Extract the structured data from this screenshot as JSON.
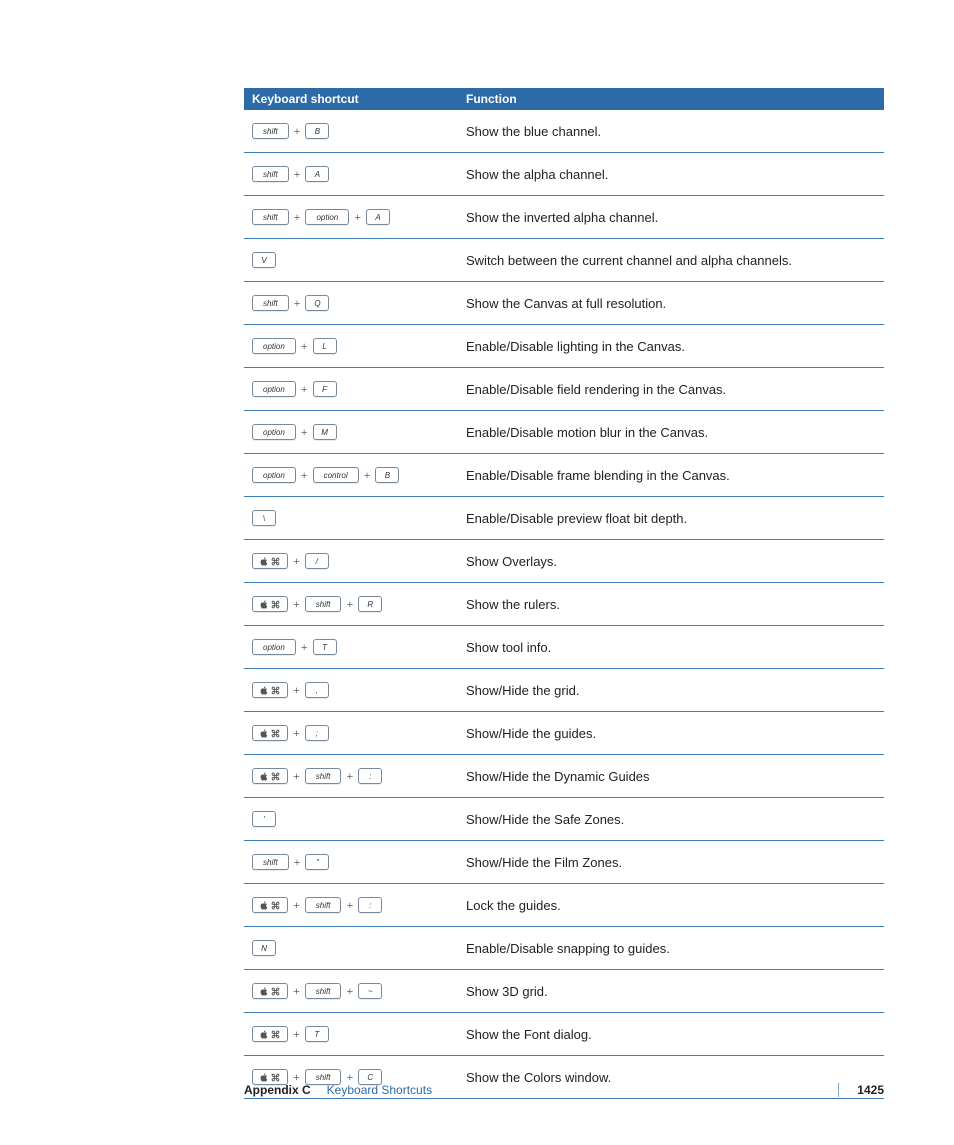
{
  "table": {
    "columns": [
      "Keyboard shortcut",
      "Function"
    ],
    "rows": [
      {
        "keys": [
          [
            "shift",
            "wide"
          ],
          [
            "B",
            "key"
          ]
        ],
        "func": "Show the blue channel."
      },
      {
        "keys": [
          [
            "shift",
            "wide"
          ],
          [
            "A",
            "key"
          ]
        ],
        "func": "Show the alpha channel."
      },
      {
        "keys": [
          [
            "shift",
            "wide"
          ],
          [
            "option",
            "wide"
          ],
          [
            "A",
            "key"
          ]
        ],
        "func": "Show the inverted alpha channel."
      },
      {
        "keys": [
          [
            "V",
            "key"
          ]
        ],
        "func": "Switch between the current channel and alpha channels."
      },
      {
        "keys": [
          [
            "shift",
            "wide"
          ],
          [
            "Q",
            "key"
          ]
        ],
        "func": "Show the Canvas at full resolution."
      },
      {
        "keys": [
          [
            "option",
            "wide"
          ],
          [
            "L",
            "key"
          ]
        ],
        "func": "Enable/Disable lighting in the Canvas."
      },
      {
        "keys": [
          [
            "option",
            "wide"
          ],
          [
            "F",
            "key"
          ]
        ],
        "func": "Enable/Disable field rendering in the Canvas."
      },
      {
        "keys": [
          [
            "option",
            "wide"
          ],
          [
            "M",
            "key"
          ]
        ],
        "func": "Enable/Disable motion blur in the Canvas."
      },
      {
        "keys": [
          [
            "option",
            "wide"
          ],
          [
            "control",
            "wide"
          ],
          [
            "B",
            "key"
          ]
        ],
        "func": "Enable/Disable frame blending in the Canvas."
      },
      {
        "keys": [
          [
            "\\",
            "key"
          ]
        ],
        "func": "Enable/Disable preview float bit depth."
      },
      {
        "keys": [
          [
            "cmd",
            "cmd"
          ],
          [
            "/",
            "key"
          ]
        ],
        "func": "Show Overlays."
      },
      {
        "keys": [
          [
            "cmd",
            "cmd"
          ],
          [
            "shift",
            "wide"
          ],
          [
            "R",
            "key"
          ]
        ],
        "func": "Show the rulers."
      },
      {
        "keys": [
          [
            "option",
            "wide"
          ],
          [
            "T",
            "key"
          ]
        ],
        "func": "Show tool info."
      },
      {
        "keys": [
          [
            "cmd",
            "cmd"
          ],
          [
            ",",
            "key"
          ]
        ],
        "func": "Show/Hide the grid."
      },
      {
        "keys": [
          [
            "cmd",
            "cmd"
          ],
          [
            ";",
            "key"
          ]
        ],
        "func": "Show/Hide the guides."
      },
      {
        "keys": [
          [
            "cmd",
            "cmd"
          ],
          [
            "shift",
            "wide"
          ],
          [
            ":",
            "key"
          ]
        ],
        "func": "Show/Hide the Dynamic Guides"
      },
      {
        "keys": [
          [
            "'",
            "key"
          ]
        ],
        "func": "Show/Hide the Safe Zones."
      },
      {
        "keys": [
          [
            "shift",
            "wide"
          ],
          [
            "\"",
            "key"
          ]
        ],
        "func": "Show/Hide the Film Zones."
      },
      {
        "keys": [
          [
            "cmd",
            "cmd"
          ],
          [
            "shift",
            "wide"
          ],
          [
            ":",
            "key"
          ]
        ],
        "func": "Lock the guides."
      },
      {
        "keys": [
          [
            "N",
            "key"
          ]
        ],
        "func": "Enable/Disable snapping to guides."
      },
      {
        "keys": [
          [
            "cmd",
            "cmd"
          ],
          [
            "shift",
            "wide"
          ],
          [
            "~",
            "key"
          ]
        ],
        "func": "Show 3D grid."
      },
      {
        "keys": [
          [
            "cmd",
            "cmd"
          ],
          [
            "T",
            "key"
          ]
        ],
        "func": "Show the Font dialog."
      },
      {
        "keys": [
          [
            "cmd",
            "cmd"
          ],
          [
            "shift",
            "wide"
          ],
          [
            "C",
            "key"
          ]
        ],
        "func": "Show the Colors window."
      }
    ]
  },
  "footer": {
    "appendix": "Appendix C",
    "section": "Keyboard Shortcuts",
    "page": "1425"
  },
  "glyphs": {
    "plus": "+"
  }
}
